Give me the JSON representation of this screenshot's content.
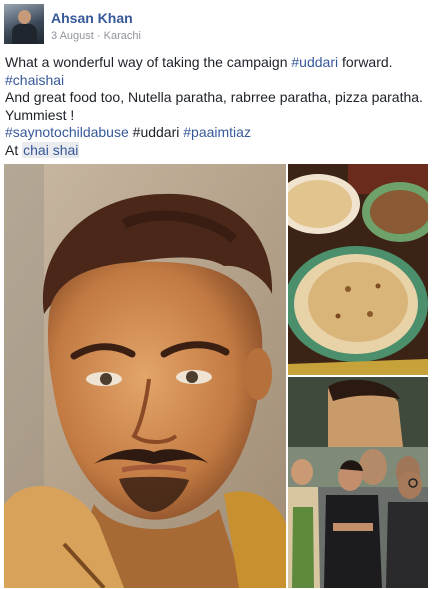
{
  "post": {
    "author": "Ahsan Khan",
    "date": "3 August",
    "separator": "·",
    "location": "Karachi",
    "lines": {
      "l1_pre": "What a wonderful way of taking the campaign ",
      "l1_tag": "#uddari",
      "l1_post": " forward.",
      "l2_tag": "#chaishai",
      "l3": "And great food too, Nutella paratha, rabrree paratha, pizza paratha.",
      "l4": "Yummiest !",
      "l5_tag1": "#saynotochildabuse",
      "l5_plain": " #uddari ",
      "l5_tag2": "#paaimtiaz",
      "l6_pre": "At ",
      "l6_place": "chai shai"
    }
  },
  "photos": [
    {
      "name": "wall-mural-portrait"
    },
    {
      "name": "paratha-plates"
    },
    {
      "name": "group-at-mural"
    }
  ],
  "colors": {
    "link": "#365899",
    "meta": "#90949c",
    "text": "#1d2129"
  }
}
